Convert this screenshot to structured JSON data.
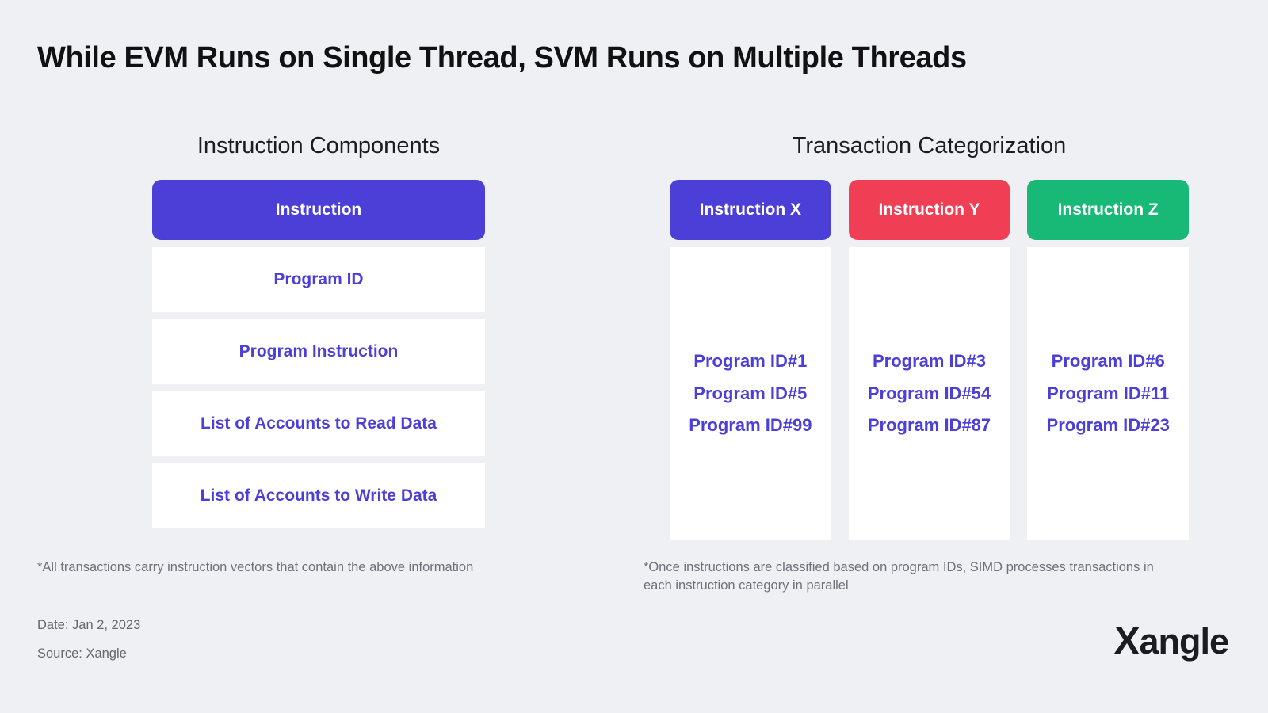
{
  "headline": "While EVM Runs on Single Thread, SVM Runs on Multiple Threads",
  "colors": {
    "background": "#eff0f4",
    "card": "#ffffff",
    "purple": "#4c3fd8",
    "red": "#f03e54",
    "green": "#18b877",
    "text_dark": "#1b1b1f",
    "text_muted": "#6f7078"
  },
  "left_panel": {
    "title": "Instruction Components",
    "header": {
      "label": "Instruction",
      "color": "#4c3fd8"
    },
    "rows": [
      {
        "label": "Program ID"
      },
      {
        "label": "Program Instruction"
      },
      {
        "label": "List of Accounts to Read Data"
      },
      {
        "label": "List of Accounts to Write Data"
      }
    ],
    "footnote": "*All transactions carry instruction vectors that contain the above information"
  },
  "right_panel": {
    "title": "Transaction Categorization",
    "categories": [
      {
        "label": "Instruction X",
        "color": "#4c3fd8",
        "program_ids": [
          "Program ID#1",
          "Program ID#5",
          "Program ID#99"
        ]
      },
      {
        "label": "Instruction Y",
        "color": "#f03e54",
        "program_ids": [
          "Program ID#3",
          "Program ID#54",
          "Program ID#87"
        ]
      },
      {
        "label": "Instruction Z",
        "color": "#18b877",
        "program_ids": [
          "Program ID#6",
          "Program ID#11",
          "Program ID#23"
        ]
      }
    ],
    "footnote": "*Once instructions are classified based on program IDs, SIMD processes transactions in each instruction category in parallel"
  },
  "footer": {
    "date": "Date: Jan 2, 2023",
    "source": "Source: Xangle",
    "logo_x": "X",
    "logo_rest": "angle"
  }
}
